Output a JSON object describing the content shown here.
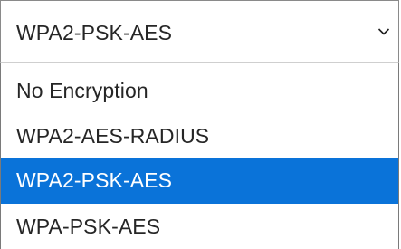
{
  "select": {
    "value": "WPA2-PSK-AES",
    "icon": "chevron-down-icon",
    "options": [
      {
        "label": "No Encryption",
        "selected": false
      },
      {
        "label": "WPA2-AES-RADIUS",
        "selected": false
      },
      {
        "label": "WPA2-PSK-AES",
        "selected": true
      },
      {
        "label": "WPA-PSK-AES",
        "selected": false
      }
    ]
  },
  "colors": {
    "selected_background": "#0a73d9",
    "selected_text": "#ffffff",
    "text": "#262626"
  }
}
